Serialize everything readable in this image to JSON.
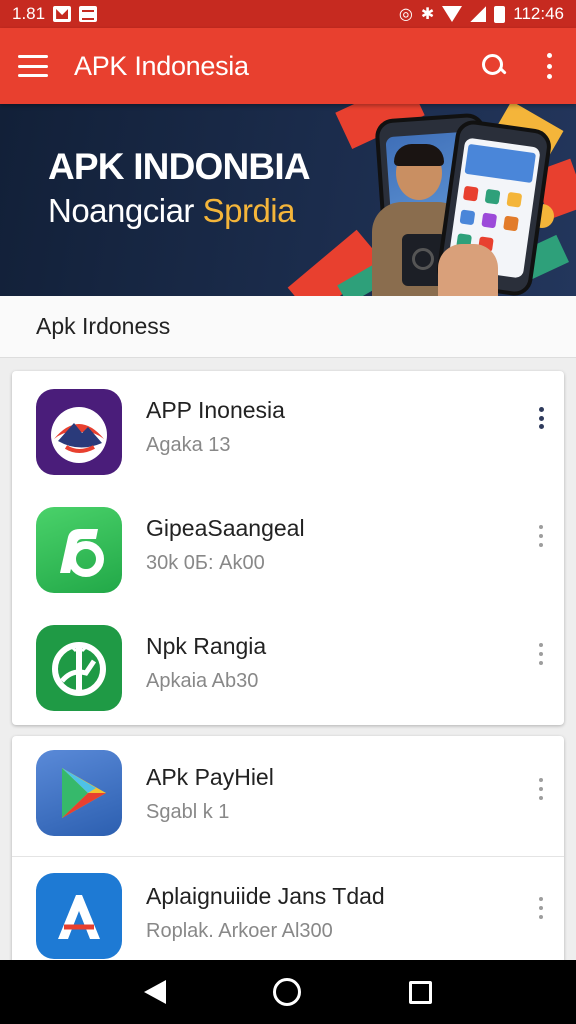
{
  "status_bar": {
    "left_text": "1.81",
    "time": "112:46"
  },
  "app_bar": {
    "title": "APK Indonesia"
  },
  "banner": {
    "title": "APK INDONBIA",
    "subtitle_part1": "Noangciar ",
    "subtitle_part2": "Sprdia"
  },
  "section": {
    "title": "Apk Irdoness"
  },
  "apps": [
    {
      "title": "APP Inonesia",
      "subtitle": "Agaka 13",
      "icon": "mountain-logo-icon"
    },
    {
      "title": "GipeaSaangeal",
      "subtitle": "30k 0Б: Ak00",
      "icon": "green-app-icon"
    },
    {
      "title": "Npk Rangia",
      "subtitle": "Apkaia Ab30",
      "icon": "android-app-icon"
    },
    {
      "title": "APk PayHiel",
      "subtitle": "Sgabl k 1",
      "icon": "play-store-icon"
    },
    {
      "title": "Aplaignuiide Jans Tdad",
      "subtitle": "Roplak. Arkoer Al300",
      "icon": "app-store-a-icon"
    }
  ],
  "colors": {
    "status_bar": "#c62a20",
    "app_bar": "#e8402f",
    "banner_bg": "#1b2c4c",
    "accent": "#f4b53a"
  }
}
